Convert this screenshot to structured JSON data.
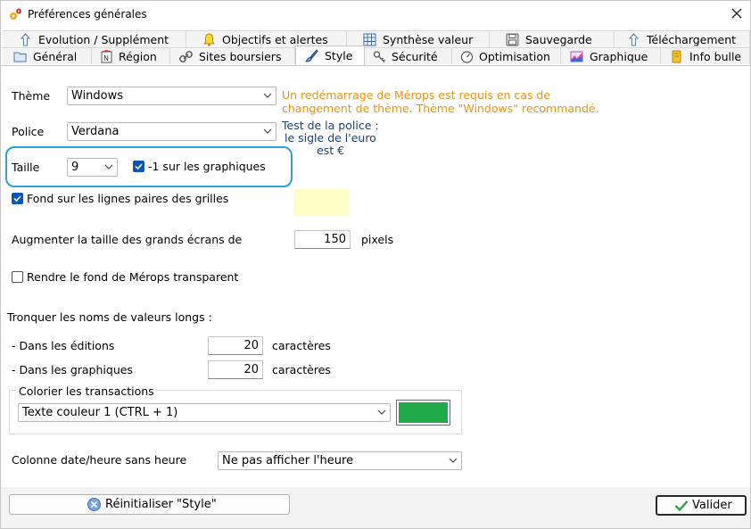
{
  "window": {
    "title": "Préférences générales"
  },
  "tabs_row1": [
    {
      "label": "Evolution / Supplément",
      "icon": "arrow-up-icon"
    },
    {
      "label": "Objectifs et alertes",
      "icon": "bell-icon"
    },
    {
      "label": "Synthèse valeur",
      "icon": "grid-icon"
    },
    {
      "label": "Sauvegarde",
      "icon": "floppy-icon"
    },
    {
      "label": "Téléchargement",
      "icon": "arrow-up-icon"
    }
  ],
  "tabs_row2": [
    {
      "label": "Général",
      "icon": "folder-icon"
    },
    {
      "label": "Région",
      "icon": "flag-icon",
      "icon_text": "N"
    },
    {
      "label": "Sites boursiers",
      "icon": "link-icon"
    },
    {
      "label": "Style",
      "icon": "brush-icon",
      "active": true
    },
    {
      "label": "Sécurité",
      "icon": "key-icon"
    },
    {
      "label": "Optimisation",
      "icon": "gauge-icon"
    },
    {
      "label": "Graphique",
      "icon": "chart-icon"
    },
    {
      "label": "Info bulle",
      "icon": "note-icon"
    }
  ],
  "style": {
    "theme_label": "Thème",
    "theme_value": "Windows",
    "theme_note_line1": "Un redémarrage de Mérops est requis en cas de",
    "theme_note_line2": "changement de thème.  Thème \"Windows\" recommandé.",
    "font_label": "Police",
    "font_value": "Verdana",
    "font_test_line1": "Test de la police :",
    "font_test_line2": "le sigle de l'euro",
    "font_test_line3": "est €",
    "size_label": "Taille",
    "size_value": "9",
    "minus_one_label": "-1 sur les graphiques",
    "minus_one_checked": true,
    "even_rows_label": "Fond sur les lignes paires des grilles",
    "even_rows_checked": true,
    "enlarge_label": "Augmenter la taille des grands écrans de",
    "enlarge_value": "150",
    "enlarge_unit": "pixels",
    "transparent_label": "Rendre le fond de Mérops transparent",
    "transparent_checked": false,
    "truncate_label": "Tronquer les noms de valeurs longs :",
    "editions_label": "- Dans les éditions",
    "editions_value": "20",
    "editions_unit": "caractères",
    "charts_label": "- Dans les graphiques",
    "charts_value": "20",
    "charts_unit": "caractères",
    "color_group_label": "Colorier les transactions",
    "color_select_value": "Texte couleur 1 (CTRL + 1)",
    "date_col_label": "Colonne date/heure sans heure",
    "date_col_value": "Ne pas afficher l'heure"
  },
  "footer": {
    "reset_label": "Réinitialiser \"Style\"",
    "ok_label": "Valider"
  },
  "colors": {
    "note_orange": "#e89419",
    "test_navy": "#1f3f7a",
    "checkbox_blue": "#0b57b7",
    "highlight": "#29a3d8",
    "swatch_green": "#22ab4b",
    "preview_yellow": "#ffffc8"
  }
}
